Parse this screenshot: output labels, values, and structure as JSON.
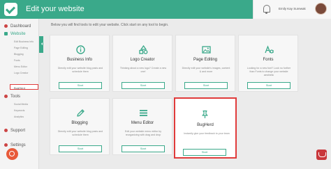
{
  "header": {
    "title": "Edit your website",
    "user_name": "Emily Kay Surewak"
  },
  "sidebar": {
    "items": [
      {
        "label": "Dashboard",
        "active": false
      },
      {
        "label": "Website",
        "active": true
      },
      {
        "label": "Tools",
        "active": false
      },
      {
        "label": "Support",
        "active": false
      },
      {
        "label": "Settings",
        "active": false
      }
    ],
    "website_subitems": [
      "Edit Business Info",
      "Page Editing",
      "Blogging",
      "Fonts",
      "Menu Editor",
      "Logo Creator",
      "BugHerd"
    ],
    "tools_subitems": [
      "Social Media",
      "Keywords",
      "Analytics"
    ]
  },
  "main": {
    "intro": "Below you will find tools to edit your website. Click start on any tool to begin.",
    "cards": [
      {
        "title": "Business Info",
        "icon": "info-icon",
        "desc": "Directly edit your website blog posts and schedule them",
        "button": "Start"
      },
      {
        "title": "Logo Creator",
        "icon": "shapes-icon",
        "desc": "Thinking about a new logo? Create a new one!",
        "button": "Start"
      },
      {
        "title": "Page Editing",
        "icon": "image-icon",
        "desc": "Directly edit your website's images, content & and more",
        "button": "Start"
      },
      {
        "title": "Fonts",
        "icon": "font-icon",
        "desc": "Looking for a new font? Look no further than Fonts to change your website aesthetic",
        "button": "Start"
      },
      {
        "title": "Blogging",
        "icon": "pencil-icon",
        "desc": "Directly edit your website blog posts and schedule them",
        "button": "Start"
      },
      {
        "title": "Menu Editor",
        "icon": "menu-icon",
        "desc": "Edit your website menu editor by reorganizing with drag and drop",
        "button": "Start"
      },
      {
        "title": "BugHerd",
        "icon": "pin-icon",
        "desc": "Instantly give your feedback to your team",
        "button": "Start"
      }
    ]
  },
  "colors": {
    "accent": "#3aa98a",
    "highlight": "#e03b3b"
  }
}
